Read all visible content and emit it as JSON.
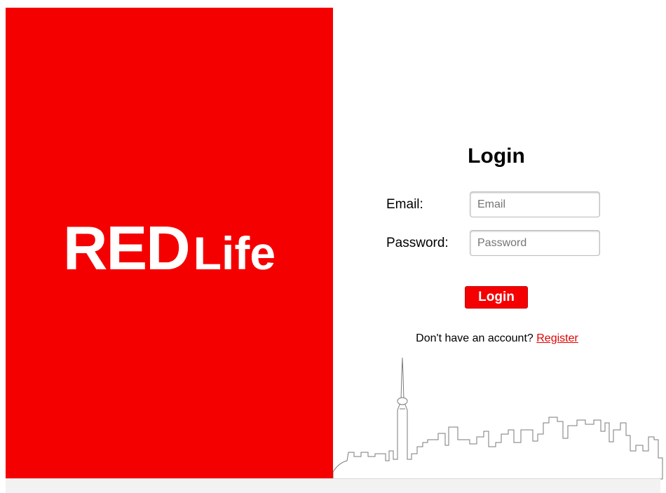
{
  "brand": {
    "title_word1": "RED",
    "title_word2": "Life",
    "color": "#f50000"
  },
  "login": {
    "heading": "Login",
    "email_label": "Email:",
    "email_placeholder": "Email",
    "password_label": "Password:",
    "password_placeholder": "Password",
    "submit_label": "Login",
    "register_prompt": "Don't have an account?",
    "register_link": "Register"
  },
  "decoration": {
    "skyline_icon": "city-skyline-icon"
  }
}
